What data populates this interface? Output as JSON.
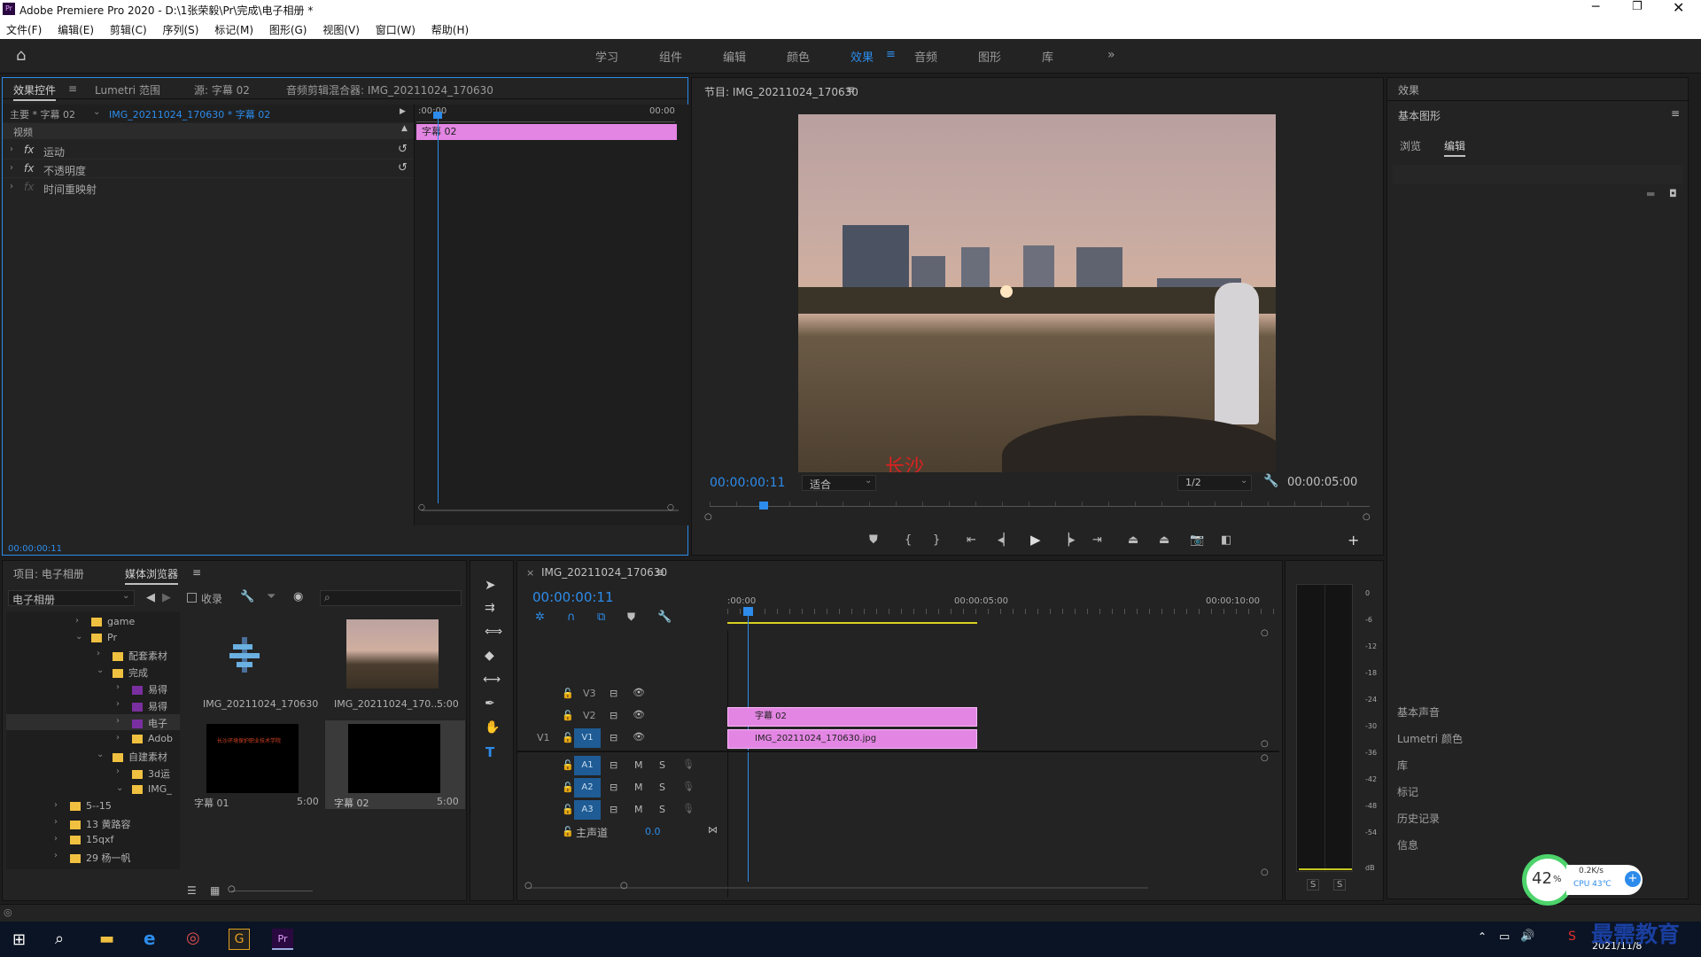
{
  "window": {
    "title": "Adobe Premiere Pro 2020 - D:\\1张荣毅\\Pr\\完成\\电子相册 *",
    "app_icon": "Pr"
  },
  "menu": [
    "文件(F)",
    "编辑(E)",
    "剪辑(C)",
    "序列(S)",
    "标记(M)",
    "图形(G)",
    "视图(V)",
    "窗口(W)",
    "帮助(H)"
  ],
  "workspaces": [
    "学习",
    "组件",
    "编辑",
    "颜色",
    "效果",
    "音频",
    "图形",
    "库"
  ],
  "effect_controls": {
    "tabs": [
      "效果控件",
      "Lumetri 范围",
      "源: 字幕 02",
      "音频剪辑混合器: IMG_20211024_170630"
    ],
    "master": "主要 * 字幕 02",
    "sequence_clip": "IMG_20211024_170630 * 字幕 02",
    "ruler_start": ":00:00",
    "ruler_end": "00:00",
    "clip_label": "字幕 02",
    "section": "视频",
    "props": [
      "运动",
      "不透明度",
      "时间重映射"
    ],
    "fx": "fx",
    "timecode": "00:00:00:11"
  },
  "program": {
    "title": "节目: IMG_20211024_170630",
    "timecode": "00:00:00:11",
    "fit": "适合",
    "resolution": "1/2",
    "duration": "00:00:05:00",
    "overlay_text": "长沙"
  },
  "right_panel": {
    "header": "效果",
    "title": "基本图形",
    "tabs": [
      "浏览",
      "编辑"
    ],
    "items": [
      "基本声音",
      "Lumetri 颜色",
      "库",
      "标记",
      "历史记录",
      "信息"
    ]
  },
  "project": {
    "tabs": [
      "项目: 电子相册",
      "媒体浏览器"
    ],
    "location": "电子相册",
    "ingest": "收录",
    "tree": [
      "game",
      "Pr",
      "配套素材",
      "完成",
      "易得",
      "易得",
      "电子",
      "Adob",
      "自建素材",
      "3d运",
      "IMG_",
      "5--15",
      "13 黄路容",
      "15qxf",
      "29 杨一帆"
    ],
    "thumbs": [
      {
        "name": "IMG_20211024_170630",
        "dur": ""
      },
      {
        "name": "IMG_20211024_170...",
        "dur": "5:00"
      },
      {
        "name": "字幕 01",
        "dur": "5:00"
      },
      {
        "name": "字幕 02",
        "dur": "5:00"
      }
    ],
    "thumb_caption": "长沙环境保护职业技术学院"
  },
  "timeline": {
    "seq": "IMG_20211024_170630",
    "timecode": "00:00:00:11",
    "ruler": [
      ":00:00",
      "00:00:05:00",
      "00:00:10:00"
    ],
    "video_tracks": [
      "V3",
      "V2",
      "V1"
    ],
    "audio_tracks": [
      "A1",
      "A2",
      "A3"
    ],
    "src_v1": "V1",
    "master": "主声道",
    "master_val": "0.0",
    "clip_title": "字幕 02",
    "clip_img": "IMG_20211024_170630.jpg",
    "m": "M",
    "s": "S"
  },
  "meter": {
    "labels": [
      "0",
      "-6",
      "-12",
      "-18",
      "-24",
      "-30",
      "-36",
      "-42",
      "-48",
      "-54",
      "dB"
    ],
    "solo": [
      "S",
      "S"
    ]
  },
  "overlay": {
    "cpu_pct": "42",
    "pct_sign": "%",
    "net": "0.2K/s",
    "cpu": "CPU 43℃"
  },
  "taskbar": {
    "date": "2021/11/8",
    "watermark": "最需教育"
  }
}
